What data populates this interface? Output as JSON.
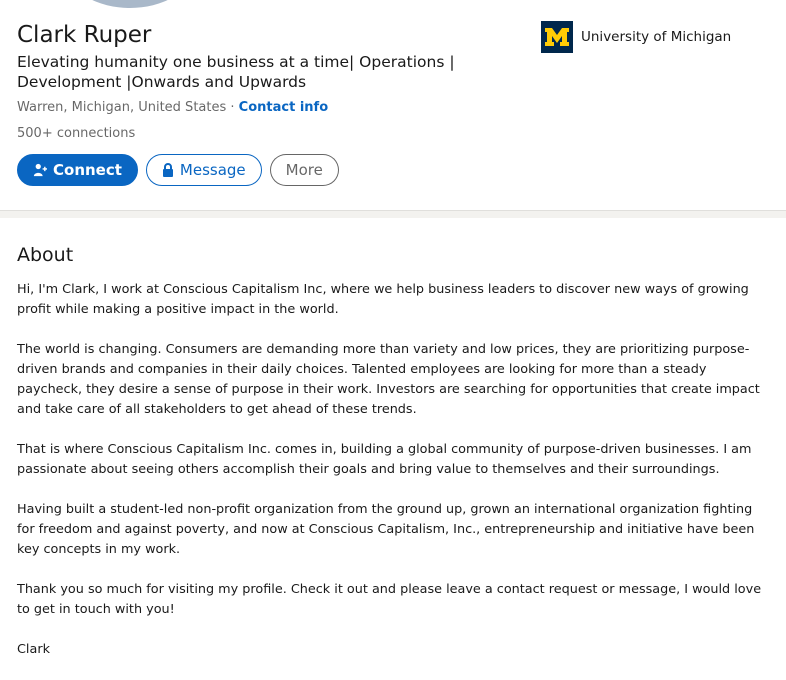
{
  "profile": {
    "name": "Clark Ruper",
    "headline": "Elevating humanity one business at a time| Operations | Development |Onwards and Upwards",
    "location": "Warren, Michigan, United States",
    "separator": "·",
    "contact_label": "Contact info",
    "connections": "500+ connections"
  },
  "actions": {
    "connect_label": "Connect",
    "message_label": "Message",
    "more_label": "More"
  },
  "education": {
    "school": "University of Michigan",
    "logo_icon": "university-of-michigan-logo",
    "logo_color": "#00274c",
    "logo_letter_color": "#ffcb05"
  },
  "about": {
    "title": "About",
    "paragraphs": [
      "Hi, I'm Clark, I work at Conscious Capitalism Inc, where we help business leaders to discover new ways of growing profit while making a positive impact in the world.",
      "The world is changing. Consumers are demanding more than variety and low prices, they are prioritizing purpose-driven brands and companies in their daily choices. Talented employees are looking for more than a steady paycheck, they desire a sense of purpose in their work. Investors are searching for opportunities that create impact and take care of all stakeholders to get ahead of these trends.",
      "That is where Conscious Capitalism Inc. comes in, building a global community of purpose-driven businesses. I am passionate about seeing others accomplish their goals and bring value to themselves and their surroundings.",
      "Having built a student-led non-profit organization from the ground up, grown an international organization fighting for freedom and against poverty, and now at Conscious Capitalism, Inc., entrepreneurship and initiative have been key concepts in my work.",
      "Thank you so much for visiting my profile. Check it out and please leave a contact request or message, I would love to get in touch with you!",
      "Clark"
    ]
  },
  "colors": {
    "brand": "#0a66c2",
    "divider": "#f3f2ef"
  }
}
